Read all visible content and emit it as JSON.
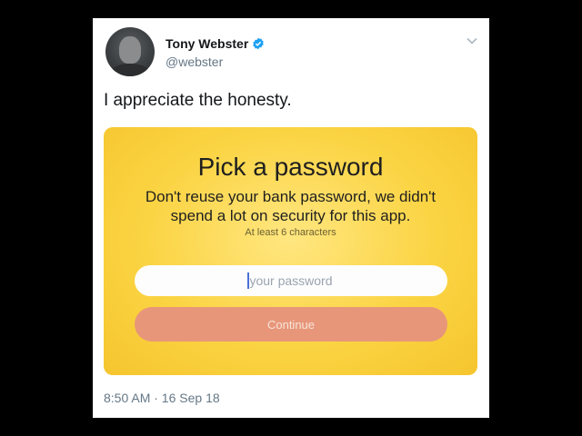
{
  "tweet": {
    "author_name": "Tony Webster",
    "author_handle": "@webster",
    "verified": true,
    "text": "I appreciate the honesty.",
    "timestamp": "8:50 AM · 16 Sep 18"
  },
  "card": {
    "title": "Pick a password",
    "subtitle": "Don't reuse your bank password, we didn't spend a lot on security for this app.",
    "hint": "At least 6 characters",
    "password_placeholder": "your password",
    "password_value": "",
    "continue_label": "Continue"
  },
  "icons": {
    "verified": "verified-badge-icon",
    "menu": "chevron-down-icon"
  },
  "colors": {
    "verified_blue": "#1da1f2",
    "card_yellow": "#fbd443",
    "continue_button": "#e8967a",
    "secondary_text": "#657786"
  }
}
